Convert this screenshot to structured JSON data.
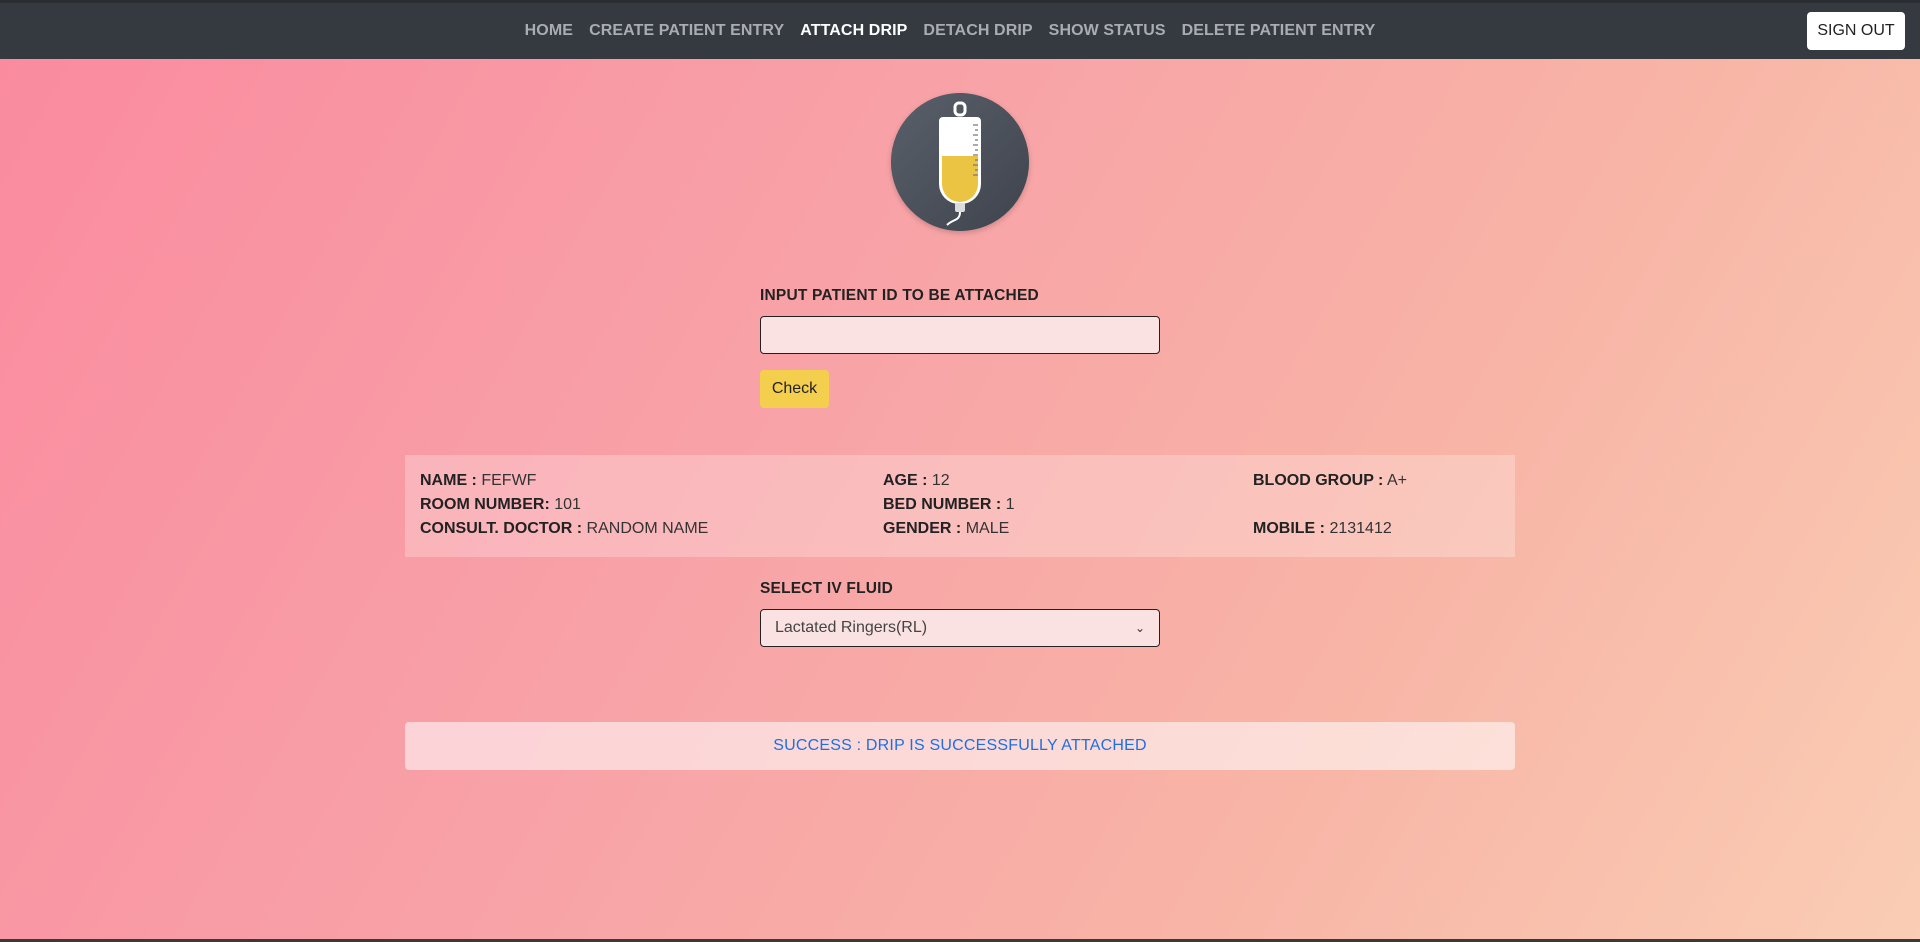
{
  "nav": {
    "links": [
      {
        "label": "HOME",
        "active": false
      },
      {
        "label": "CREATE PATIENT ENTRY",
        "active": false
      },
      {
        "label": "ATTACH DRIP",
        "active": true
      },
      {
        "label": "DETACH DRIP",
        "active": false
      },
      {
        "label": "SHOW STATUS",
        "active": false
      },
      {
        "label": "DELETE PATIENT ENTRY",
        "active": false
      }
    ],
    "signout_label": "SIGN OUT"
  },
  "logo": {
    "icon": "iv-drip-bag-icon"
  },
  "patient_id": {
    "label": "INPUT PATIENT ID TO BE ATTACHED",
    "value": "",
    "check_label": "Check"
  },
  "patient": {
    "name_label": "NAME :",
    "name": "FEFWF",
    "age_label": "AGE :",
    "age": "12",
    "blood_group_label": "BLOOD GROUP :",
    "blood_group": "A+",
    "room_label": "ROOM NUMBER:",
    "room": "101",
    "bed_label": "BED NUMBER :",
    "bed": "1",
    "doctor_label": "CONSULT. DOCTOR :",
    "doctor": "RANDOM NAME",
    "gender_label": "GENDER :",
    "gender": "MALE",
    "mobile_label": "MOBILE :",
    "mobile": "2131412"
  },
  "iv_fluid": {
    "label": "SELECT IV FLUID",
    "selected": "Lactated Ringers(RL)"
  },
  "alert": {
    "message": "SUCCESS : DRIP IS SUCCESSFULLY ATTACHED"
  },
  "colors": {
    "navbar": "#343a40",
    "check_button": "#f4cf4d",
    "alert_text": "#1e6fe6"
  }
}
